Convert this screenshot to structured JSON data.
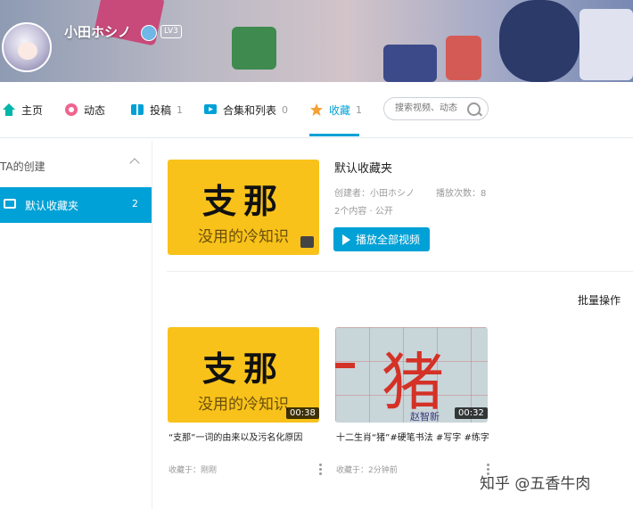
{
  "profile": {
    "username": "小田ホシノ",
    "level": "LV3"
  },
  "nav": {
    "items": [
      {
        "label": "主页",
        "count": "",
        "icon": "home-icon",
        "color": "#00b5a9"
      },
      {
        "label": "动态",
        "count": "",
        "icon": "dynamic-icon",
        "color": "#f0648d"
      },
      {
        "label": "投稿",
        "count": "1",
        "icon": "upload-icon",
        "color": "#00a1d6"
      },
      {
        "label": "合集和列表",
        "count": "0",
        "icon": "collection-icon",
        "color": "#00a1d6"
      },
      {
        "label": "收藏",
        "count": "1",
        "icon": "favorite-star-icon",
        "color": "#f3a034"
      }
    ],
    "search_placeholder": "搜索视频、动态"
  },
  "sidebar": {
    "section_title": "TA的创建",
    "items": [
      {
        "label": "默认收藏夹",
        "count": "2"
      }
    ]
  },
  "folder": {
    "cover_big": "支那",
    "cover_small": "没用的冷知识",
    "name": "默认收藏夹",
    "creator": "创建者：小田ホシノ",
    "plays": "播放次数：8",
    "contents": "2个内容 · 公开",
    "play_all": "播放全部视频",
    "batch": "批量操作"
  },
  "videos": [
    {
      "cover_big": "支那",
      "cover_small": "没用的冷知识",
      "duration": "00:38",
      "title": "“支那”一词的由来以及污名化原因",
      "fav_time": "收藏于：刚刚"
    },
    {
      "cover_char": "猪",
      "cover_sig": "赵智新",
      "duration": "00:32",
      "title": "十二生肖“猪”#硬笔书法 #写字 #练字",
      "fav_time": "收藏于：2分钟前"
    }
  ],
  "watermark": "知乎 @五香牛肉",
  "colors": {
    "accent": "#00a1d6",
    "cover": "#f8c21a"
  }
}
